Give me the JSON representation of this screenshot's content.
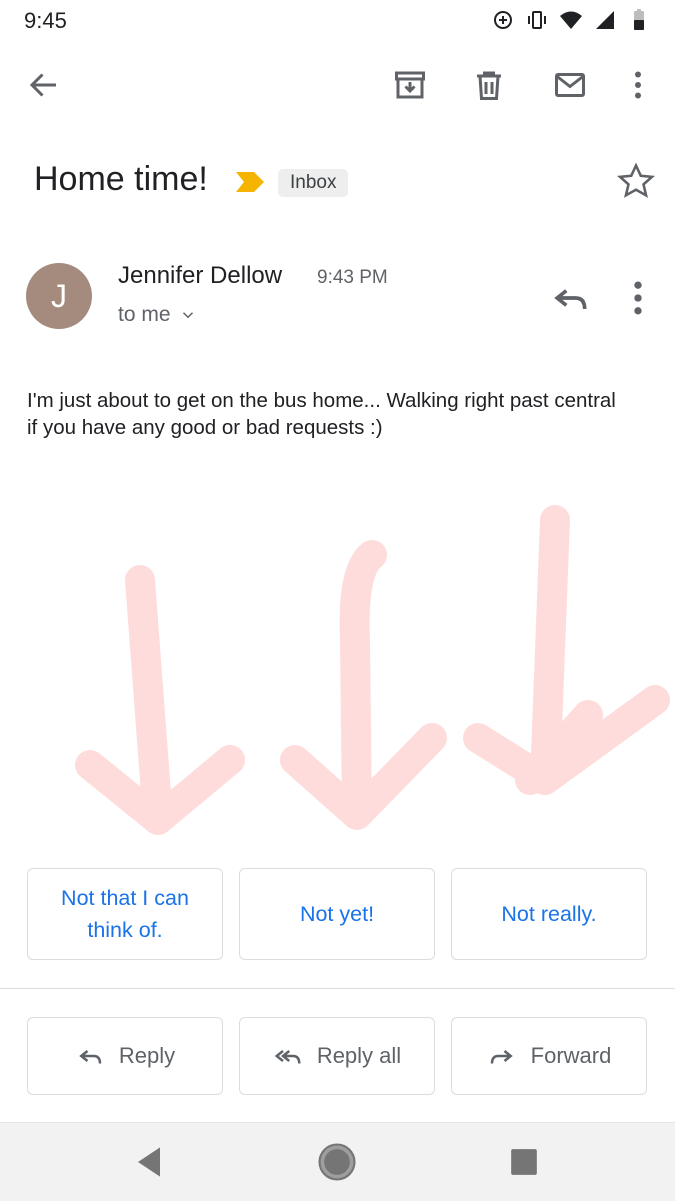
{
  "status_bar": {
    "time": "9:45"
  },
  "toolbar": {
    "back_icon": "arrow-back-icon",
    "archive_icon": "archive-icon",
    "delete_icon": "trash-icon",
    "mark_unread_icon": "mail-icon",
    "more_icon": "more-vert-icon"
  },
  "email": {
    "subject": "Home time!",
    "label": "Inbox",
    "sender_initial": "J",
    "sender_name": "Jennifer Dellow",
    "time": "9:43 PM",
    "recipient": "to me",
    "body": "I'm just about to get on the bus home... Walking right past central if you have any good or bad requests :)"
  },
  "smart_replies": [
    "Not that I can think of.",
    "Not yet!",
    "Not really."
  ],
  "actions": {
    "reply": "Reply",
    "reply_all": "Reply all",
    "forward": "Forward"
  },
  "colors": {
    "accent": "#1a73e8",
    "importance": "#f4b400",
    "avatar": "#a48b7e",
    "annotation": "#ff8a8a"
  }
}
